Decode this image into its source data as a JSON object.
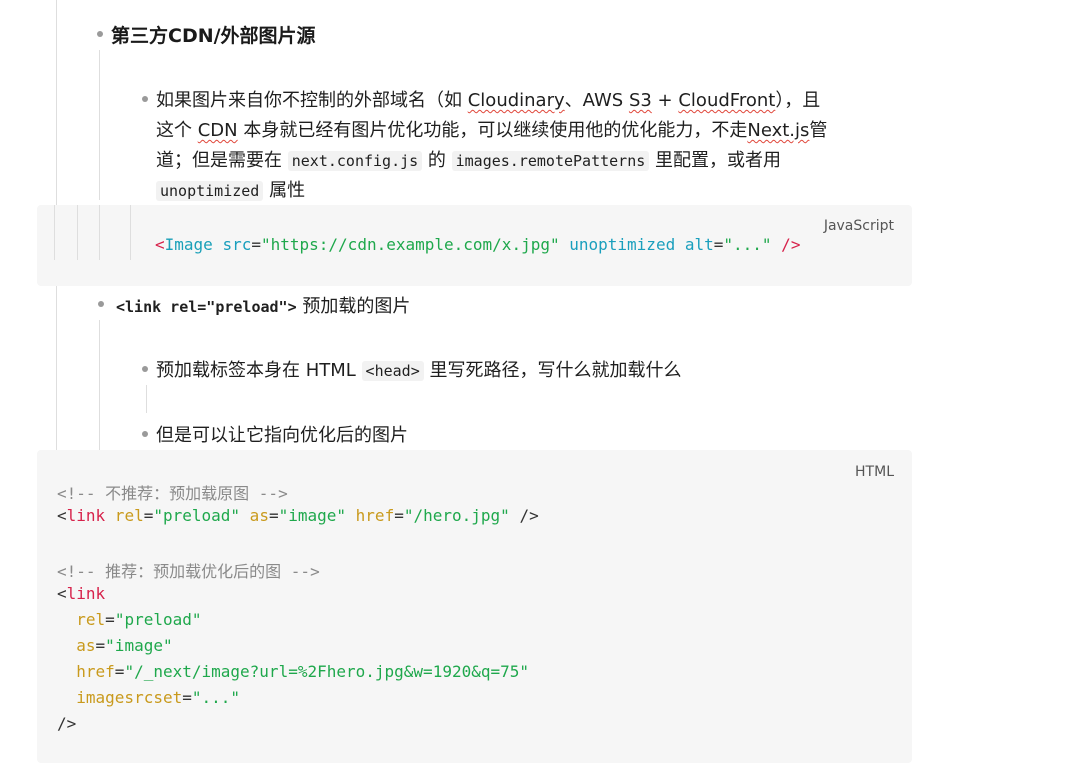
{
  "sections": {
    "cdn_heading": "第三方CDN/外部图片源",
    "cdn_para": {
      "l1_a": "如果图片来自你不控制的外部域名（如 ",
      "l1_cloudinary": "Cloudinary",
      "l1_b": "、AWS ",
      "l1_s3": "S3",
      "l1_c": " + ",
      "l1_cloudfront": "CloudFront",
      "l1_d": "），且",
      "l2_a": "这个 ",
      "l2_cdn": "CDN",
      "l2_b": " 本身就已经有图片优化功能，可以继续使用他的优化能力，不走",
      "l2_next": "Next.js",
      "l2_c": "管",
      "l3_a": "道；但是需要在 ",
      "l3_code1": "next.config.js",
      "l3_b": " 的 ",
      "l3_code2": "images.remotePatterns",
      "l3_c": " 里配置，或者用",
      "l4_code": "unoptimized",
      "l4_b": " 属性"
    },
    "js_block": {
      "lang": "JavaScript",
      "tag_open": "<",
      "component": "Image",
      "a1": " src",
      "eq": "=",
      "v1": "\"https://cdn.example.com/x.jpg\"",
      "a2": " unoptimized",
      "a3": " alt",
      "v3": "\"...\"",
      "tag_close": " />"
    },
    "link_heading": {
      "code": "<link rel=\"preload\">",
      "text": " 预加载的图片"
    },
    "link_item1": {
      "a": "预加载标签本身在 HTML ",
      "code": "<head>",
      "b": " 里写死路径，写什么就加载什么"
    },
    "link_item2": "但是可以让它指向优化后的图片",
    "html_block": {
      "lang": "HTML",
      "c1": "<!-- 不推荐：预加载原图 -->",
      "l2_lt": "<",
      "l2_tag": "link",
      "l2_rel": " rel",
      "l2_relv": "\"preload\"",
      "l2_as": " as",
      "l2_asv": "\"image\"",
      "l2_href": " href",
      "l2_hrefv": "\"/hero.jpg\"",
      "l2_end": " />",
      "c2": "<!-- 推荐：预加载优化后的图 -->",
      "l4_lt": "<",
      "l4_tag": "link",
      "l5_attr": "  rel",
      "l5_val": "\"preload\"",
      "l6_attr": "  as",
      "l6_val": "\"image\"",
      "l7_attr": "  href",
      "l7_val": "\"/_next/image?url=%2Fhero.jpg&w=1920&q=75\"",
      "l8_attr": "  imagesrcset",
      "l8_val": "\"...\"",
      "l9": "/>",
      "eq": "="
    }
  }
}
